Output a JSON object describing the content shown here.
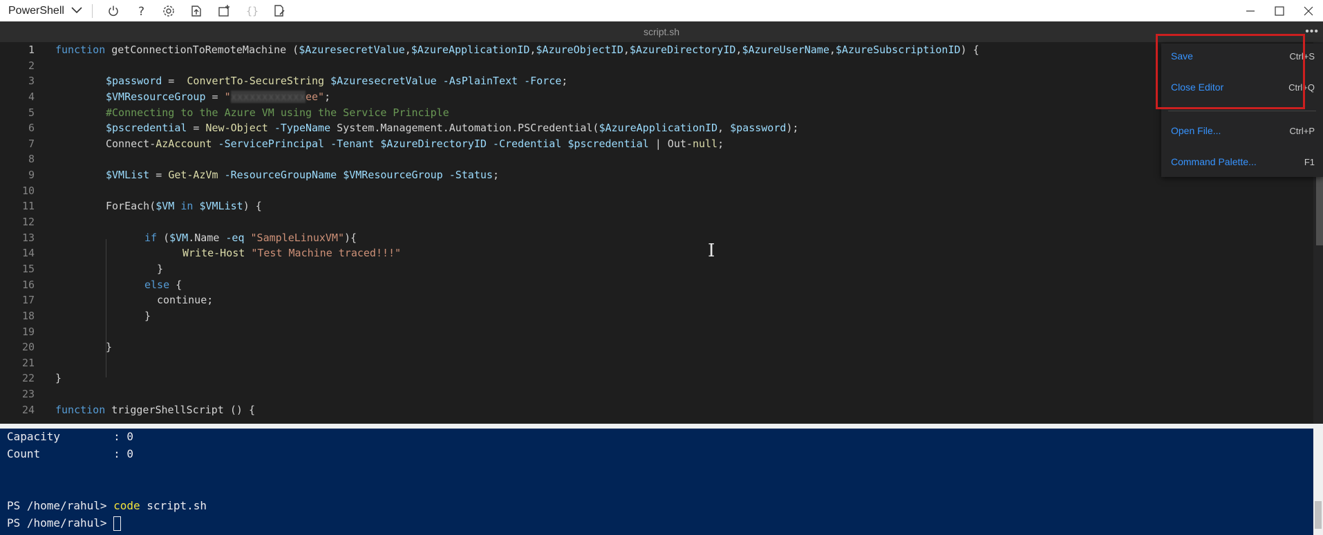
{
  "toolbar": {
    "shell": "PowerShell",
    "icons": [
      "power-icon",
      "help-icon",
      "settings-icon",
      "upload-icon",
      "download-icon",
      "braces-icon",
      "open-editor-icon"
    ]
  },
  "editor": {
    "tab_title": "script.sh",
    "more_label": "•••"
  },
  "code_lines": [
    {
      "n": "1"
    },
    {
      "n": "2"
    },
    {
      "n": "3"
    },
    {
      "n": "4"
    },
    {
      "n": "5"
    },
    {
      "n": "6"
    },
    {
      "n": "7"
    },
    {
      "n": "8"
    },
    {
      "n": "9"
    },
    {
      "n": "10"
    },
    {
      "n": "11"
    },
    {
      "n": "12"
    },
    {
      "n": "13"
    },
    {
      "n": "14"
    },
    {
      "n": "15"
    },
    {
      "n": "16"
    },
    {
      "n": "17"
    },
    {
      "n": "18"
    },
    {
      "n": "19"
    },
    {
      "n": "20"
    },
    {
      "n": "21"
    },
    {
      "n": "22"
    },
    {
      "n": "23"
    },
    {
      "n": "24"
    }
  ],
  "code": {
    "l1": {
      "kw": "function",
      "fn": "getConnectionToRemoteMachine",
      "p0": " (",
      "v1": "$AzuresecretValue",
      "v2": "$AzureApplicationID",
      "v3": "$AzureObjectID",
      "v4": "$AzureDirectoryID",
      "v5": "$AzureUserName",
      "v6": "$AzureSubscriptionID",
      "end": ") {"
    },
    "l3": {
      "v": "$password",
      "eq": " =  ",
      "fn": "ConvertTo-SecureString",
      "sp": " ",
      "v2": "$AzuresecretValue",
      "opt": " -AsPlainText -Force",
      ";": ";"
    },
    "l4": {
      "v": "$VMResourceGroup",
      "eq": " = ",
      "q": "\"",
      "blur": "xxxxxxxxxxxx",
      "s": "ee\"",
      ";": ";"
    },
    "l5": {
      "cmt": "#Connecting to the Azure VM using the Service Principle"
    },
    "l6": {
      "v": "$pscredential",
      "eq": " = ",
      "fn": "New-Object",
      "opt": " -TypeName ",
      "cls": "System.Management.Automation.PSCredential(",
      "v2": "$AzureApplicationID",
      "c": ", ",
      "v3": "$password",
      "end": ");"
    },
    "l7": {
      "a": "Connect-",
      "fn": "AzAccount",
      "o1": " -ServicePrincipal -Tenant ",
      "v1": "$AzureDirectoryID",
      "o2": " -Credential ",
      "v2": "$pscredential",
      "pipe": " | Out-",
      "nul": "null",
      ";": ";"
    },
    "l9": {
      "v": "$VMList",
      "eq": " = ",
      "fn": "Get-AzVm",
      "o1": " -ResourceGroupName ",
      "v2": "$VMResourceGroup",
      "o2": " -Status",
      ";": ";"
    },
    "l11": {
      "a": "ForEach(",
      "v": "$VM",
      "kw": " in ",
      "v2": "$VMList",
      "end": ") {"
    },
    "l13": {
      "kw": "if",
      "p": " (",
      "v": "$VM",
      "n": ".Name",
      "op": " -eq ",
      "s": "\"SampleLinuxVM\"",
      "end": "){"
    },
    "l14": {
      "fn": "Write-Host",
      "sp": " ",
      "s": "\"Test Machine traced!!!\""
    },
    "l15": {
      "t": "}"
    },
    "l16": {
      "kw": "else",
      "t": " {"
    },
    "l17": {
      "t": "continue;"
    },
    "l18": {
      "t": "}"
    },
    "l20": {
      "t": "}"
    },
    "l22": {
      "t": "}"
    },
    "l24": {
      "kw": "function",
      "fn": "triggerShellScript",
      "t": " () {"
    }
  },
  "menu": {
    "items": [
      {
        "label": "Save",
        "key": "Ctrl+S"
      },
      {
        "label": "Close Editor",
        "key": "Ctrl+Q"
      },
      {
        "label": "Open File...",
        "key": "Ctrl+P"
      },
      {
        "label": "Command Palette...",
        "key": "F1"
      }
    ]
  },
  "terminal": {
    "capacity": "Capacity        : 0",
    "count": "Count           : 0",
    "prompt1": "PS /home/rahul> ",
    "cmd": "code",
    "arg": " script.sh",
    "prompt2": "PS /home/rahul> "
  }
}
